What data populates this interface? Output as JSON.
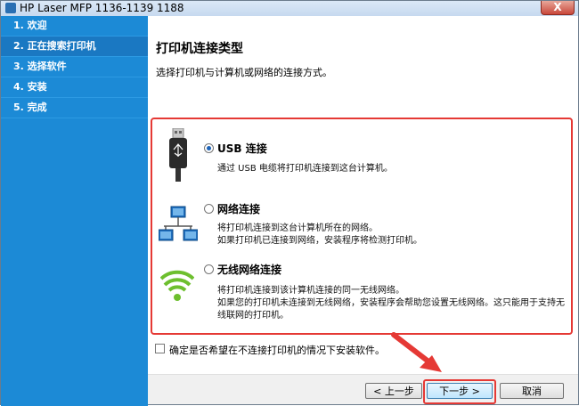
{
  "window": {
    "title": "HP Laser MFP 1136-1139 1188",
    "close_label": "X"
  },
  "sidebar": {
    "steps": [
      {
        "label": "1. 欢迎"
      },
      {
        "label": "2. 正在搜索打印机"
      },
      {
        "label": "3. 选择软件"
      },
      {
        "label": "4. 安装"
      },
      {
        "label": "5. 完成"
      }
    ],
    "current_index": 1
  },
  "main": {
    "heading": "打印机连接类型",
    "subtitle": "选择打印机与计算机或网络的连接方式。",
    "options": [
      {
        "label": "USB 连接",
        "selected": true,
        "desc_lines": [
          "通过 USB 电缆将打印机连接到这台计算机。"
        ],
        "icon": "usb-cable-icon"
      },
      {
        "label": "网络连接",
        "selected": false,
        "desc_lines": [
          "将打印机连接到这台计算机所在的网络。",
          "如果打印机已连接到网络，安装程序将检测打印机。"
        ],
        "icon": "network-icon"
      },
      {
        "label": "无线网络连接",
        "selected": false,
        "desc_lines": [
          "将打印机连接到该计算机连接的同一无线网络。",
          "如果您的打印机未连接到无线网络，安装程序会帮助您设置无线网络。这只能用于支持无",
          "线联网的打印机。"
        ],
        "icon": "wifi-icon"
      }
    ],
    "checkbox": {
      "label": "确定是否希望在不连接打印机的情况下安装软件。",
      "checked": false
    }
  },
  "footer": {
    "back_label": "< 上一步",
    "next_label": "下一步 >",
    "cancel_label": "取消"
  },
  "colors": {
    "sidebar": "#1c8ad6",
    "highlight": "#e53935"
  }
}
